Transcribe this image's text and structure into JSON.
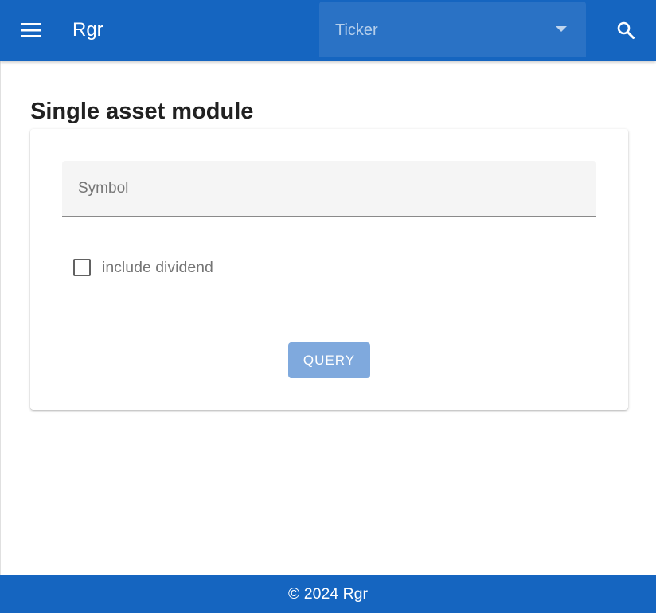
{
  "header": {
    "app_title": "Rgr",
    "menu_icon": "menu-icon",
    "search_icon": "search-icon",
    "ticker_select": {
      "label": "Ticker",
      "icon": "arrow-drop-down-icon"
    }
  },
  "main": {
    "page_title": "Single asset module",
    "form": {
      "symbol_field": {
        "label": "Symbol",
        "value": ""
      },
      "include_dividend": {
        "label": "include dividend",
        "checked": false
      },
      "query_button": {
        "label": "QUERY",
        "enabled": false
      }
    }
  },
  "footer": {
    "text": "© 2024 Rgr"
  },
  "colors": {
    "primary": "#1565c0",
    "button_disabled": "#7fa9dd",
    "field_background": "#f5f5f5",
    "title_text": "#212121",
    "secondary_text": "#757575"
  }
}
